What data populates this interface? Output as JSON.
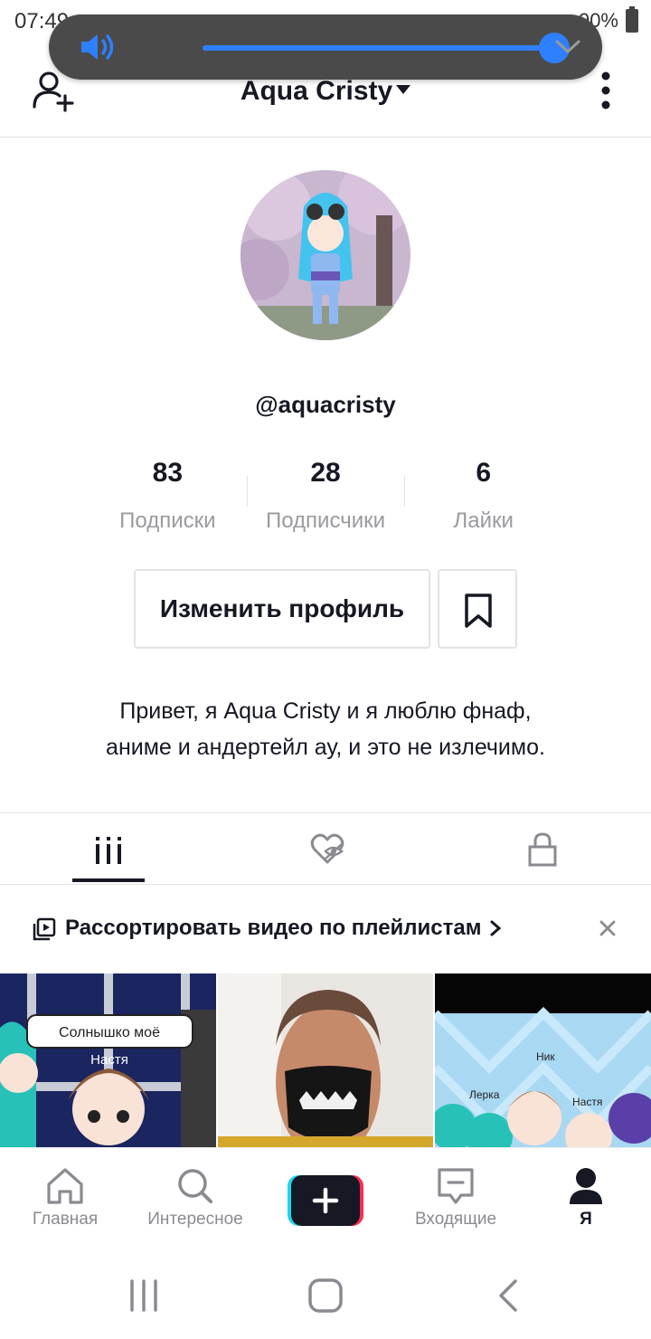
{
  "status_bar": {
    "time": "07:49",
    "battery": "90%"
  },
  "volume_overlay": {
    "level_percent": 100
  },
  "header": {
    "title": "Aqua Cristy"
  },
  "profile": {
    "username": "@aquacristy",
    "stats": [
      {
        "value": "83",
        "label": "Подписки"
      },
      {
        "value": "28",
        "label": "Подписчики"
      },
      {
        "value": "6",
        "label": "Лайки"
      }
    ],
    "edit_button_label": "Изменить профиль",
    "bio_lines": [
      "Привет, я Aqua Cristy и я люблю фнаф,",
      "аниме и андертейл ау, и это не излечимо."
    ]
  },
  "playlist_banner": {
    "text": "Рассортировать видео по плейлистам"
  },
  "thumbnails": {
    "first": {
      "caption": "Солнышко моё",
      "name_label": "Настя"
    },
    "third": {
      "names": [
        "Ник",
        "Лерка",
        "Настя"
      ]
    }
  },
  "bottom_nav": [
    {
      "label": "Главная"
    },
    {
      "label": "Интересное"
    },
    {
      "label": "Входящие"
    },
    {
      "label": "Я"
    }
  ]
}
